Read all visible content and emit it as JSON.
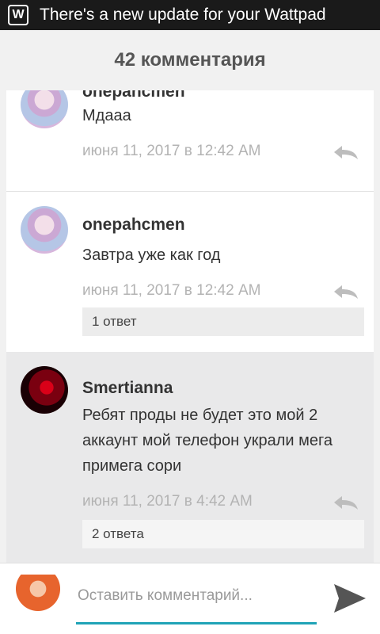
{
  "status_bar": {
    "icon": "wattpad-w-icon",
    "icon_glyph": "W",
    "text": "There's a new update for your Wattpad"
  },
  "header": {
    "title": "42 комментария"
  },
  "comments": [
    {
      "username": "onepancmen",
      "text": "Мдааа",
      "time": "июня 11, 2017 в 12:42 AM",
      "replies_label": ""
    },
    {
      "username": "onepahcmen",
      "text": "Завтра уже как год",
      "time": "июня 11, 2017 в 12:42 AM",
      "replies_label": "1 ответ"
    },
    {
      "username": "Smertianna",
      "text": "Ребят проды не будет это мой 2 аккаунт мой телефон украли мега примега сори",
      "time": "июня 11, 2017 в 4:42 AM",
      "replies_label": "2 ответа"
    }
  ],
  "composer": {
    "placeholder": "Оставить комментарий...",
    "underline_color": "#20a3b7"
  }
}
